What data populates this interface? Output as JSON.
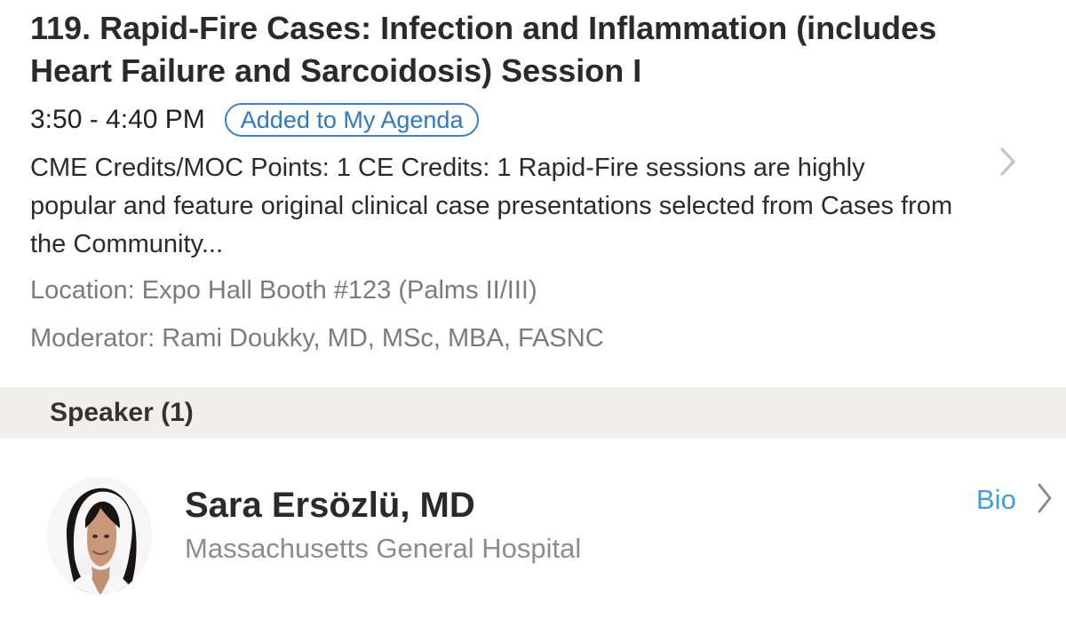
{
  "session": {
    "title": "119. Rapid-Fire Cases: Infection and Inflammation (includes Heart Failure and Sarcoidosis) Session I",
    "time": "3:50 - 4:40 PM",
    "agenda_status": "Added to My Agenda",
    "description": "CME Credits/MOC Points: 1 CE Credits: 1 Rapid-Fire sessions are highly popular and feature original clinical case presentations selected from Cases from the Community...",
    "location": "Location: Expo Hall  Booth #123 (Palms II/III)",
    "moderator": "Moderator: Rami Doukky, MD, MSc, MBA, FASNC",
    "chevron_icon": "chevron-right-icon"
  },
  "speaker_section": {
    "title": "Speaker (1)",
    "speakers": [
      {
        "name": "Sara Ersözlü, MD",
        "organization": "Massachusetts General Hospital",
        "bio_label": "Bio",
        "avatar_icon": "speaker-photo",
        "chevron_icon": "chevron-right-icon"
      }
    ]
  },
  "colors": {
    "background": "#ffffff",
    "section_header_background": "#f1efed",
    "agenda_badge_blue": "#2f78c2",
    "bio_link_blue": "#3aa1dc",
    "muted_text": "#7b7b7b",
    "chevron": "#c5c5c7"
  }
}
